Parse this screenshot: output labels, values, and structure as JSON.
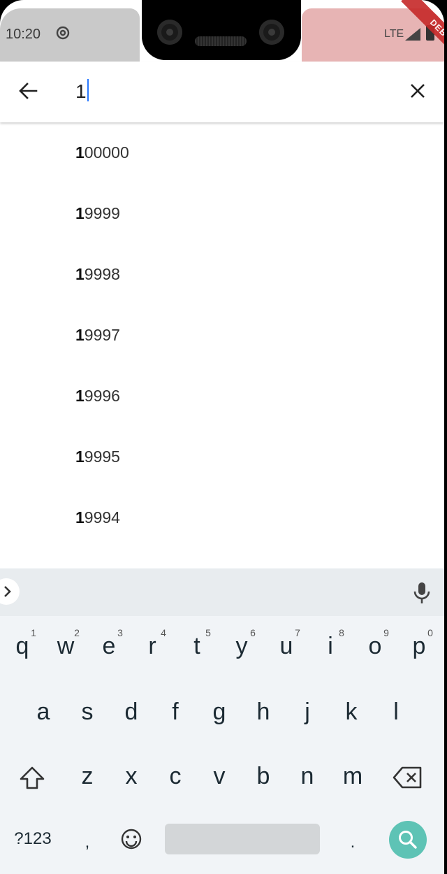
{
  "status_bar": {
    "time": "10:20",
    "network": "LTE",
    "debug_banner": "DEBUG"
  },
  "search": {
    "query": "1"
  },
  "results": [
    {
      "match": "1",
      "rest": "00000"
    },
    {
      "match": "1",
      "rest": "9999"
    },
    {
      "match": "1",
      "rest": "9998"
    },
    {
      "match": "1",
      "rest": "9997"
    },
    {
      "match": "1",
      "rest": "9996"
    },
    {
      "match": "1",
      "rest": "9995"
    },
    {
      "match": "1",
      "rest": "9994"
    }
  ],
  "keyboard": {
    "row1": [
      "q",
      "w",
      "e",
      "r",
      "t",
      "y",
      "u",
      "i",
      "o",
      "p"
    ],
    "row1_numbers": [
      "1",
      "2",
      "3",
      "4",
      "5",
      "6",
      "7",
      "8",
      "9",
      "0"
    ],
    "row2": [
      "a",
      "s",
      "d",
      "f",
      "g",
      "h",
      "j",
      "k",
      "l"
    ],
    "row3": [
      "z",
      "x",
      "c",
      "v",
      "b",
      "n",
      "m"
    ],
    "symbols_label": "?123",
    "comma": ",",
    "period": "."
  }
}
